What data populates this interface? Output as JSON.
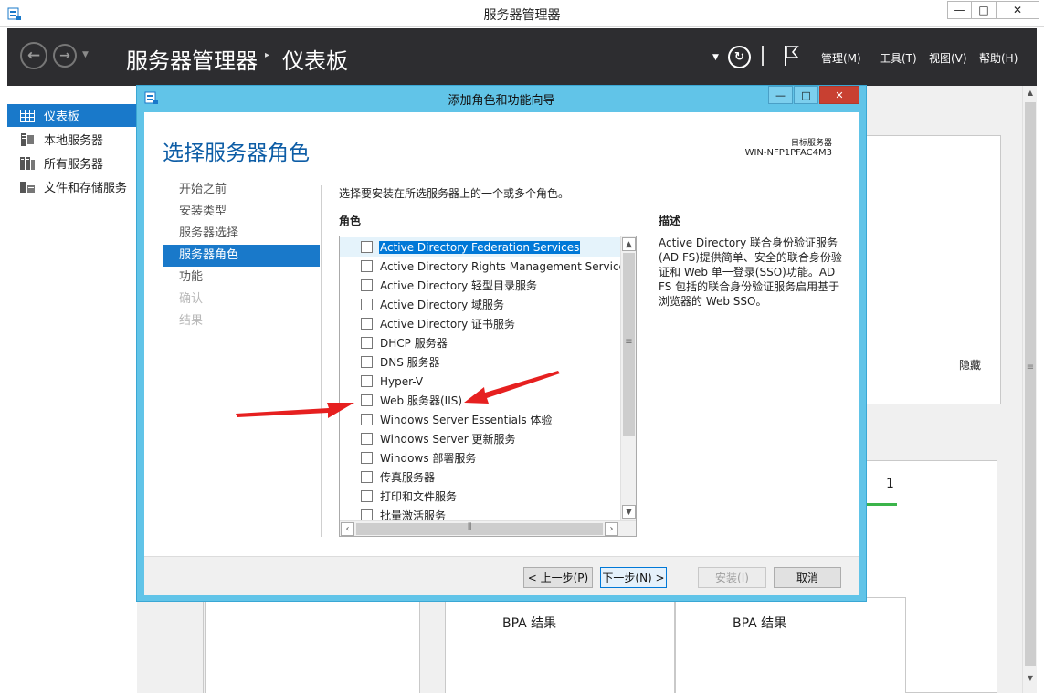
{
  "outer_window": {
    "title": "服务器管理器",
    "controls": {
      "minimize": "—",
      "maximize": "□",
      "close": "✕"
    }
  },
  "header": {
    "breadcrumb_root": "服务器管理器",
    "breadcrumb_separator": "▸",
    "breadcrumb_page": "仪表板",
    "menus": {
      "manage": "管理(M)",
      "tools": "工具(T)",
      "view": "视图(V)",
      "help": "帮助(H)"
    }
  },
  "sidebar": {
    "items": [
      {
        "label": "仪表板",
        "icon": "dashboard-icon",
        "active": true
      },
      {
        "label": "本地服务器",
        "icon": "server-icon",
        "active": false
      },
      {
        "label": "所有服务器",
        "icon": "servers-icon",
        "active": false
      },
      {
        "label": "文件和存储服务",
        "icon": "storage-icon",
        "active": false
      }
    ]
  },
  "dashboard": {
    "hide_label": "隐藏",
    "count": "1",
    "bpa_results_1": "BPA 结果",
    "bpa_results_2": "BPA 结果"
  },
  "wizard": {
    "title": "添加角色和功能向导",
    "controls": {
      "minimize": "—",
      "maximize": "□",
      "close": "✕"
    },
    "heading": "选择服务器角色",
    "target_label": "目标服务器",
    "target_server": "WIN-NFP1PFAC4M3",
    "steps": [
      {
        "label": "开始之前",
        "state": "normal"
      },
      {
        "label": "安装类型",
        "state": "normal"
      },
      {
        "label": "服务器选择",
        "state": "normal"
      },
      {
        "label": "服务器角色",
        "state": "active"
      },
      {
        "label": "功能",
        "state": "normal"
      },
      {
        "label": "确认",
        "state": "disabled"
      },
      {
        "label": "结果",
        "state": "disabled"
      }
    ],
    "instruction": "选择要安装在所选服务器上的一个或多个角色。",
    "roles_header": "角色",
    "description_header": "描述",
    "description": "Active Directory 联合身份验证服务 (AD FS)提供简单、安全的联合身份验证和 Web 单一登录(SSO)功能。AD FS 包括的联合身份验证服务启用基于浏览器的 Web SSO。",
    "roles": [
      {
        "label": "Active Directory Federation Services",
        "checked": false,
        "selected": true
      },
      {
        "label": "Active Directory Rights Management Services",
        "checked": false,
        "selected": false
      },
      {
        "label": "Active Directory 轻型目录服务",
        "checked": false,
        "selected": false
      },
      {
        "label": "Active Directory 域服务",
        "checked": false,
        "selected": false
      },
      {
        "label": "Active Directory 证书服务",
        "checked": false,
        "selected": false
      },
      {
        "label": "DHCP 服务器",
        "checked": false,
        "selected": false
      },
      {
        "label": "DNS 服务器",
        "checked": false,
        "selected": false
      },
      {
        "label": "Hyper-V",
        "checked": false,
        "selected": false
      },
      {
        "label": "Web 服务器(IIS)",
        "checked": false,
        "selected": false
      },
      {
        "label": "Windows Server Essentials 体验",
        "checked": false,
        "selected": false
      },
      {
        "label": "Windows Server 更新服务",
        "checked": false,
        "selected": false
      },
      {
        "label": "Windows 部署服务",
        "checked": false,
        "selected": false
      },
      {
        "label": "传真服务器",
        "checked": false,
        "selected": false
      },
      {
        "label": "打印和文件服务",
        "checked": false,
        "selected": false
      },
      {
        "label": "批量激活服务",
        "checked": false,
        "selected": false
      }
    ],
    "buttons": {
      "previous": "< 上一步(P)",
      "next": "下一步(N) >",
      "install": "安装(I)",
      "cancel": "取消"
    }
  },
  "colors": {
    "accent_blue": "#1979ca",
    "header_dark": "#2d2d30",
    "wizard_frame": "#61c4e8",
    "heading_blue": "#0d5da6",
    "annotation_red": "#e62020"
  }
}
